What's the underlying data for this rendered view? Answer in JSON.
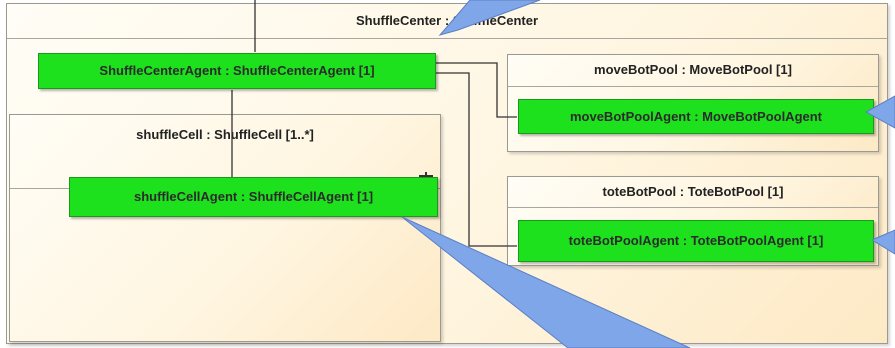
{
  "parts": {
    "shuffle_center": "ShuffleCenter : ShuffleCenter",
    "shuffle_cell": "shuffleCell : ShuffleCell [1..*]",
    "move_bot_pool": "moveBotPool : MoveBotPool [1]",
    "tote_bot_pool": "toteBotPool : ToteBotPool [1]"
  },
  "agents": {
    "shuffle_center_agent": "ShuffleCenterAgent : ShuffleCenterAgent [1]",
    "shuffle_cell_agent": "shuffleCellAgent : ShuffleCellAgent [1]",
    "move_bot_pool_agent": "moveBotPoolAgent : MoveBotPoolAgent",
    "tote_bot_pool_agent": "toteBotPoolAgent : ToteBotPoolAgent [1]"
  },
  "colors": {
    "agent_fill": "#1ee11e",
    "callout_fill": "#7fa6e8",
    "connector": "#333333"
  },
  "icons": {
    "multiplicity": "multiple-part-fork-icon"
  }
}
